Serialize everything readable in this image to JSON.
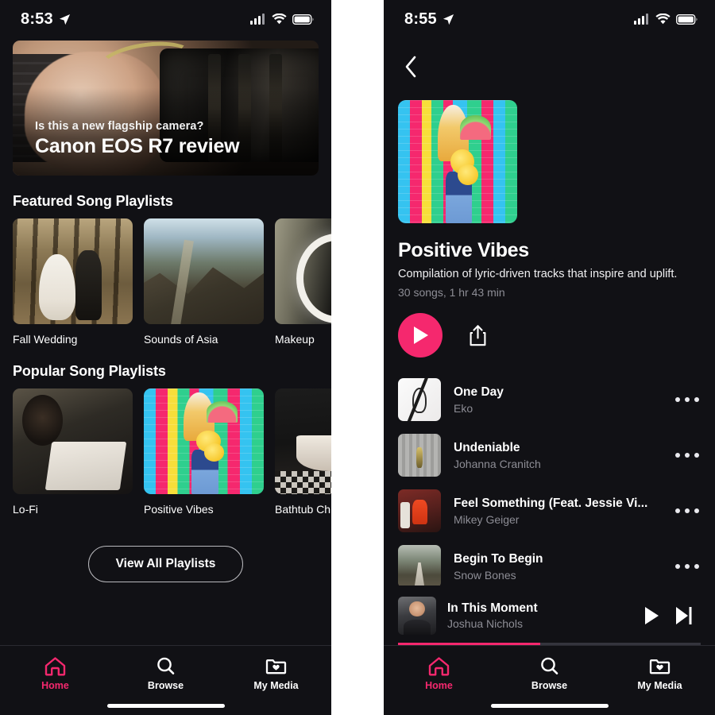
{
  "left_phone": {
    "status": {
      "time": "8:53",
      "location_icon": "location-arrow-icon",
      "signal_icon": "cellular-signal-icon",
      "wifi_icon": "wifi-icon",
      "battery_icon": "battery-full-icon"
    },
    "hero": {
      "kicker": "Is this a new flagship camera?",
      "title": "Canon EOS R7 review"
    },
    "sections": [
      {
        "heading": "Featured Song Playlists",
        "cards": [
          {
            "label": "Fall Wedding",
            "art": "art-wedding"
          },
          {
            "label": "Sounds of Asia",
            "art": "art-asia"
          },
          {
            "label": "Makeup",
            "art": "art-makeup"
          }
        ]
      },
      {
        "heading": "Popular Song Playlists",
        "cards": [
          {
            "label": "Lo-Fi",
            "art": "art-lofi"
          },
          {
            "label": "Positive Vibes",
            "art": "art-positive"
          },
          {
            "label": "Bathtub Ch",
            "art": "art-bathtub"
          }
        ]
      }
    ],
    "view_all_label": "View All Playlists",
    "tabs": [
      {
        "label": "Home",
        "icon": "home-icon",
        "active": true
      },
      {
        "label": "Browse",
        "icon": "search-icon",
        "active": false
      },
      {
        "label": "My Media",
        "icon": "folder-heart-icon",
        "active": false
      }
    ]
  },
  "right_phone": {
    "status": {
      "time": "8:55",
      "location_icon": "location-arrow-icon",
      "signal_icon": "cellular-signal-icon",
      "wifi_icon": "wifi-icon",
      "battery_icon": "battery-full-icon"
    },
    "back_icon": "chevron-left-icon",
    "playlist": {
      "cover_art": "art-positive",
      "title": "Positive Vibes",
      "description": "Compilation of lyric-driven tracks that inspire and uplift.",
      "meta": "30 songs, 1 hr 43 min",
      "play_label": "play-icon",
      "share_label": "share-icon"
    },
    "tracks": [
      {
        "title": "One Day",
        "artist": "Eko",
        "art": "ta-oneday",
        "more": "more-options-icon"
      },
      {
        "title": "Undeniable",
        "artist": "Johanna Cranitch",
        "art": "ta-undeniable",
        "more": "more-options-icon"
      },
      {
        "title": "Feel Something (Feat. Jessie Vi...",
        "artist": "Mikey Geiger",
        "art": "ta-feel",
        "more": "more-options-icon"
      },
      {
        "title": "Begin To Begin",
        "artist": "Snow Bones",
        "art": "ta-begin",
        "more": "more-options-icon"
      }
    ],
    "mini_player": {
      "title": "In This Moment",
      "artist": "Joshua Nichols",
      "art": "ta-moment",
      "play_icon": "play-icon",
      "next_icon": "skip-next-icon",
      "progress_percent": 47
    },
    "tabs": [
      {
        "label": "Home",
        "icon": "home-icon",
        "active": true
      },
      {
        "label": "Browse",
        "icon": "search-icon",
        "active": false
      },
      {
        "label": "My Media",
        "icon": "folder-heart-icon",
        "active": false
      }
    ]
  },
  "theme": {
    "accent": "#f5286e",
    "background": "#111115",
    "muted_text": "#8d8d95"
  }
}
